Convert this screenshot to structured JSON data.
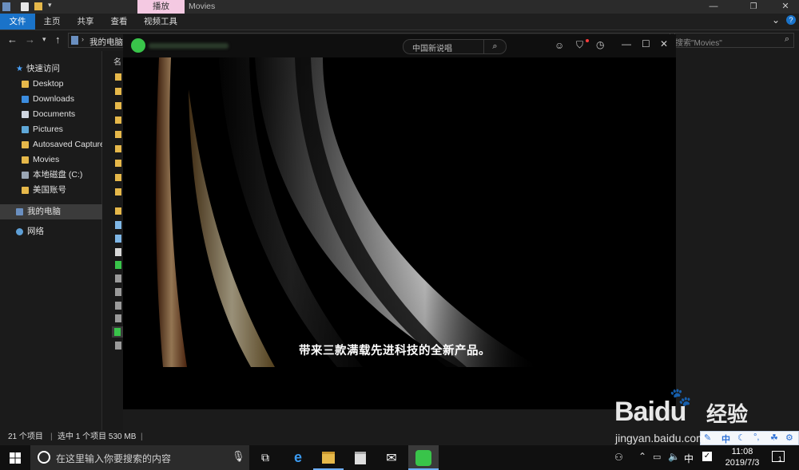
{
  "explorer": {
    "context_tab": "播放",
    "window_title": "Movies",
    "ribbon_tabs": [
      "文件",
      "主页",
      "共享",
      "查看",
      "视频工具"
    ],
    "breadcrumb": "我的电脑",
    "search_placeholder": "搜索\"Movies\"",
    "column_header_fragment": "名",
    "sidebar": {
      "quick_access": "快速访问",
      "items": [
        {
          "label": "Desktop",
          "pinned": true
        },
        {
          "label": "Downloads",
          "pinned": true
        },
        {
          "label": "Documents",
          "pinned": true
        },
        {
          "label": "Pictures",
          "pinned": true
        },
        {
          "label": "Autosaved Capture",
          "pinned": false
        },
        {
          "label": "Movies",
          "pinned": false
        },
        {
          "label": "本地磁盘 (C:)",
          "pinned": false
        },
        {
          "label": "美国账号",
          "pinned": false
        }
      ],
      "this_pc": "我的电脑",
      "network": "网络"
    },
    "status": {
      "item_count": "21 个项目",
      "selection": "选中 1 个项目 530 MB"
    }
  },
  "player": {
    "search_text": "中国新说唱",
    "subtitle": "带来三款满载先进科技的全新产品。"
  },
  "taskbar": {
    "search_placeholder": "在这里输入你要搜索的内容",
    "ime_lang": "中",
    "time": "11:08",
    "date": "2019/7/3",
    "notification_count": "1"
  },
  "ime_toolbar": {
    "lang": "中"
  },
  "watermark": {
    "brand": "Baidu",
    "cn": "经验",
    "url": "jingyan.baidu.com"
  },
  "colors": {
    "context_tab_bg": "#f4c9e2",
    "file_tab_bg": "#1a73c9",
    "player_accent": "#39c44a"
  }
}
